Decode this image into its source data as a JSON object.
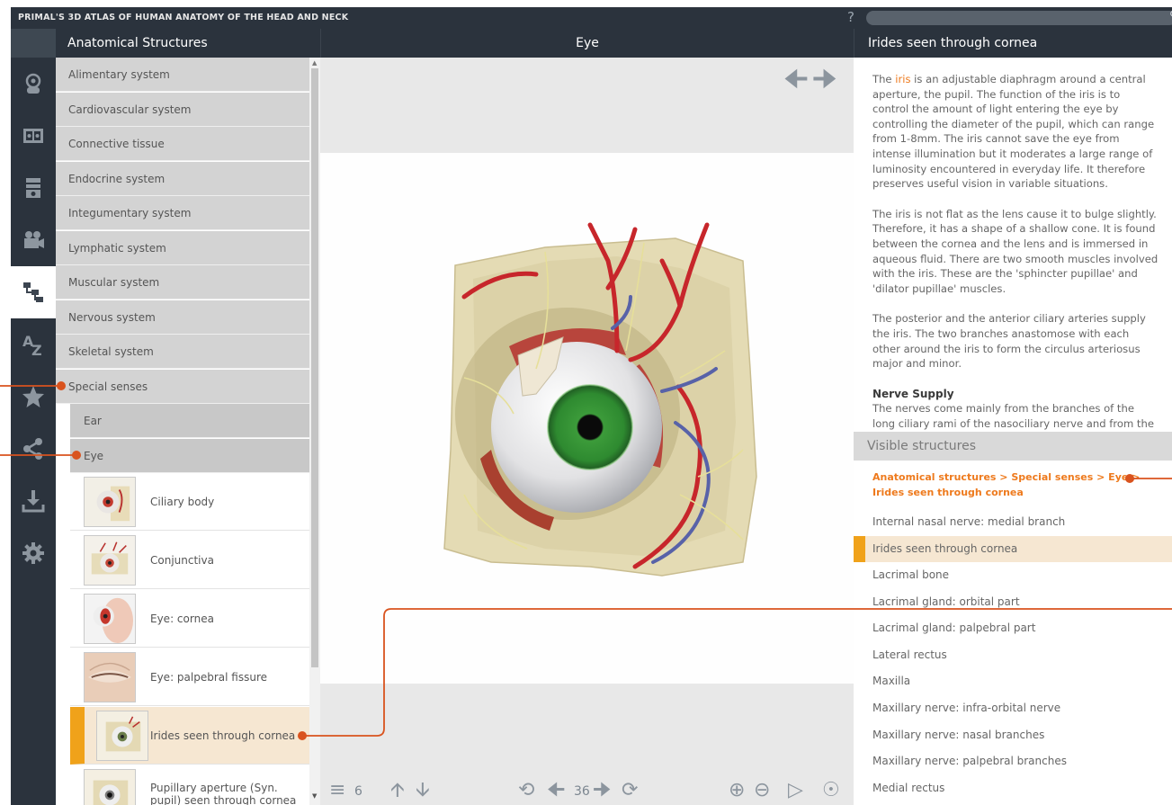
{
  "app": {
    "title": "PRIMAL'S 3D ATLAS OF HUMAN ANATOMY OF THE HEAD AND NECK",
    "help": "?"
  },
  "headers": {
    "structures": "Anatomical Structures",
    "viewer": "Eye",
    "description": "Irides seen through cornea"
  },
  "sidebar": [
    {
      "icon": "rotate-view-icon",
      "active": false
    },
    {
      "icon": "slides-icon",
      "active": false
    },
    {
      "icon": "quiz-icon",
      "active": false
    },
    {
      "icon": "video-camera-icon",
      "active": false
    },
    {
      "icon": "hierarchy-tree-icon",
      "active": true
    },
    {
      "icon": "a-z-index-icon",
      "active": false
    },
    {
      "icon": "favorites-star-icon",
      "active": false
    },
    {
      "icon": "share-icon",
      "active": false
    },
    {
      "icon": "download-icon",
      "active": false
    },
    {
      "icon": "settings-gear-icon",
      "active": false
    }
  ],
  "categories": [
    "Alimentary system",
    "Cardiovascular system",
    "Connective tissue",
    "Endocrine system",
    "Integumentary system",
    "Lymphatic system",
    "Muscular system",
    "Nervous system",
    "Skeletal system",
    "Special senses"
  ],
  "subcategories": [
    "Ear",
    "Eye"
  ],
  "structures": [
    {
      "label": "Ciliary body",
      "selected": false
    },
    {
      "label": "Conjunctiva",
      "selected": false
    },
    {
      "label": "Eye: cornea",
      "selected": false
    },
    {
      "label": "Eye: palpebral fissure",
      "selected": false
    },
    {
      "label": "Irides seen through cornea",
      "selected": true
    },
    {
      "label": "Pupillary aperture (Syn. pupil) seen through cornea",
      "selected": false
    }
  ],
  "toolbar": {
    "layers_count": "6",
    "rotation_count": "36"
  },
  "description": {
    "p1_before": "The ",
    "p1_link": "iris",
    "p1_after": " is an adjustable diaphragm around a central aperture, the pupil. The function of the iris is to control the amount of light entering the eye by controlling the diameter of the pupil, which can range from 1-8mm. The iris cannot save the eye from intense illumination but it moderates a large range of luminosity encountered in everyday life. It therefore preserves useful vision in variable situations.",
    "p2": "The iris is not flat as the lens cause it to bulge slightly. Therefore, it has a shape of a shallow cone. It is found between the cornea and the lens and is immersed in aqueous fluid. There are two smooth muscles involved with the iris. These are the 'sphincter pupillae' and 'dilator pupillae' muscles.",
    "p3": "The posterior and the anterior ciliary arteries supply the iris. The two branches anastomose with each other around the iris to form the circulus arteriosus major and minor.",
    "h_nerve": "Nerve Supply",
    "p4": "The nerves come mainly from the branches of the long ciliary rami of the nasociliary nerve and from the"
  },
  "visible": {
    "header": "Visible structures",
    "breadcrumb_line1": "Anatomical structures > Special senses > Eye >",
    "breadcrumb_line2": "Irides seen through cornea",
    "items": [
      {
        "label": "Internal nasal nerve: medial branch",
        "selected": false
      },
      {
        "label": "Irides seen through cornea",
        "selected": true
      },
      {
        "label": "Lacrimal bone",
        "selected": false
      },
      {
        "label": "Lacrimal gland: orbital part",
        "selected": false
      },
      {
        "label": "Lacrimal gland: palpebral part",
        "selected": false
      },
      {
        "label": "Lateral rectus",
        "selected": false
      },
      {
        "label": "Maxilla",
        "selected": false
      },
      {
        "label": "Maxillary nerve: infra-orbital nerve",
        "selected": false
      },
      {
        "label": "Maxillary nerve: nasal branches",
        "selected": false
      },
      {
        "label": "Maxillary nerve: palpebral branches",
        "selected": false
      },
      {
        "label": "Medial rectus",
        "selected": false
      }
    ]
  },
  "colors": {
    "dark": "#2b333d",
    "accent": "#ee7a1d",
    "selection": "#f0a21a"
  }
}
